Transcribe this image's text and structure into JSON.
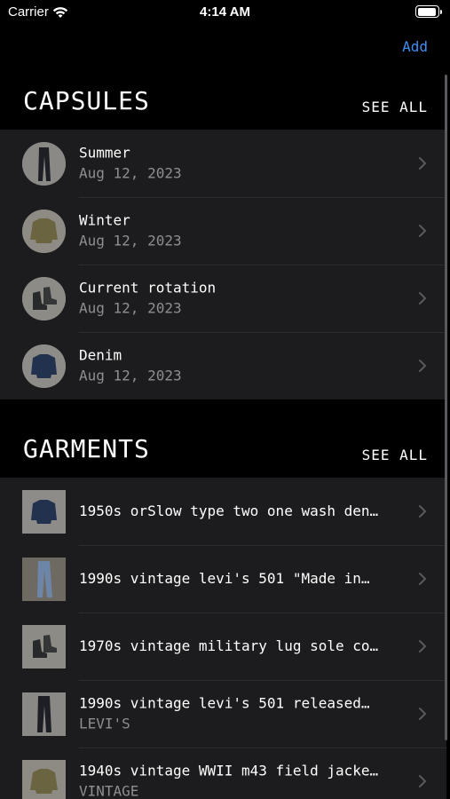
{
  "status_bar": {
    "carrier": "Carrier",
    "time": "4:14 AM"
  },
  "nav": {
    "add_label": "Add"
  },
  "capsules": {
    "title": "CAPSULES",
    "see_all": "SEE ALL",
    "items": [
      {
        "name": "Summer",
        "date": "Aug 12, 2023",
        "icon": "jeans-thumbnail"
      },
      {
        "name": "Winter",
        "date": "Aug 12, 2023",
        "icon": "jacket-thumbnail"
      },
      {
        "name": "Current rotation",
        "date": "Aug 12, 2023",
        "icon": "boots-thumbnail"
      },
      {
        "name": "Denim",
        "date": "Aug 12, 2023",
        "icon": "denim-jacket-thumbnail"
      }
    ]
  },
  "garments": {
    "title": "GARMENTS",
    "see_all": "SEE ALL",
    "items": [
      {
        "name": "1950s orSlow type two one wash den…",
        "brand": "",
        "icon": "denim-jacket-thumbnail"
      },
      {
        "name": "1990s vintage levi's 501 \"Made in…",
        "brand": "",
        "icon": "light-jeans-thumbnail"
      },
      {
        "name": "1970s vintage military lug sole co…",
        "brand": "",
        "icon": "boots-thumbnail"
      },
      {
        "name": "1990s vintage levi's 501 released…",
        "brand": "LEVI'S",
        "icon": "jeans-thumbnail"
      },
      {
        "name": "1940s vintage WWII m43 field jacke…",
        "brand": "VINTAGE",
        "icon": "jacket-thumbnail"
      }
    ]
  },
  "colors": {
    "background": "#000000",
    "row_background": "#1c1c1e",
    "accent": "#3d8ff5",
    "secondary_text": "#8e8e93"
  }
}
